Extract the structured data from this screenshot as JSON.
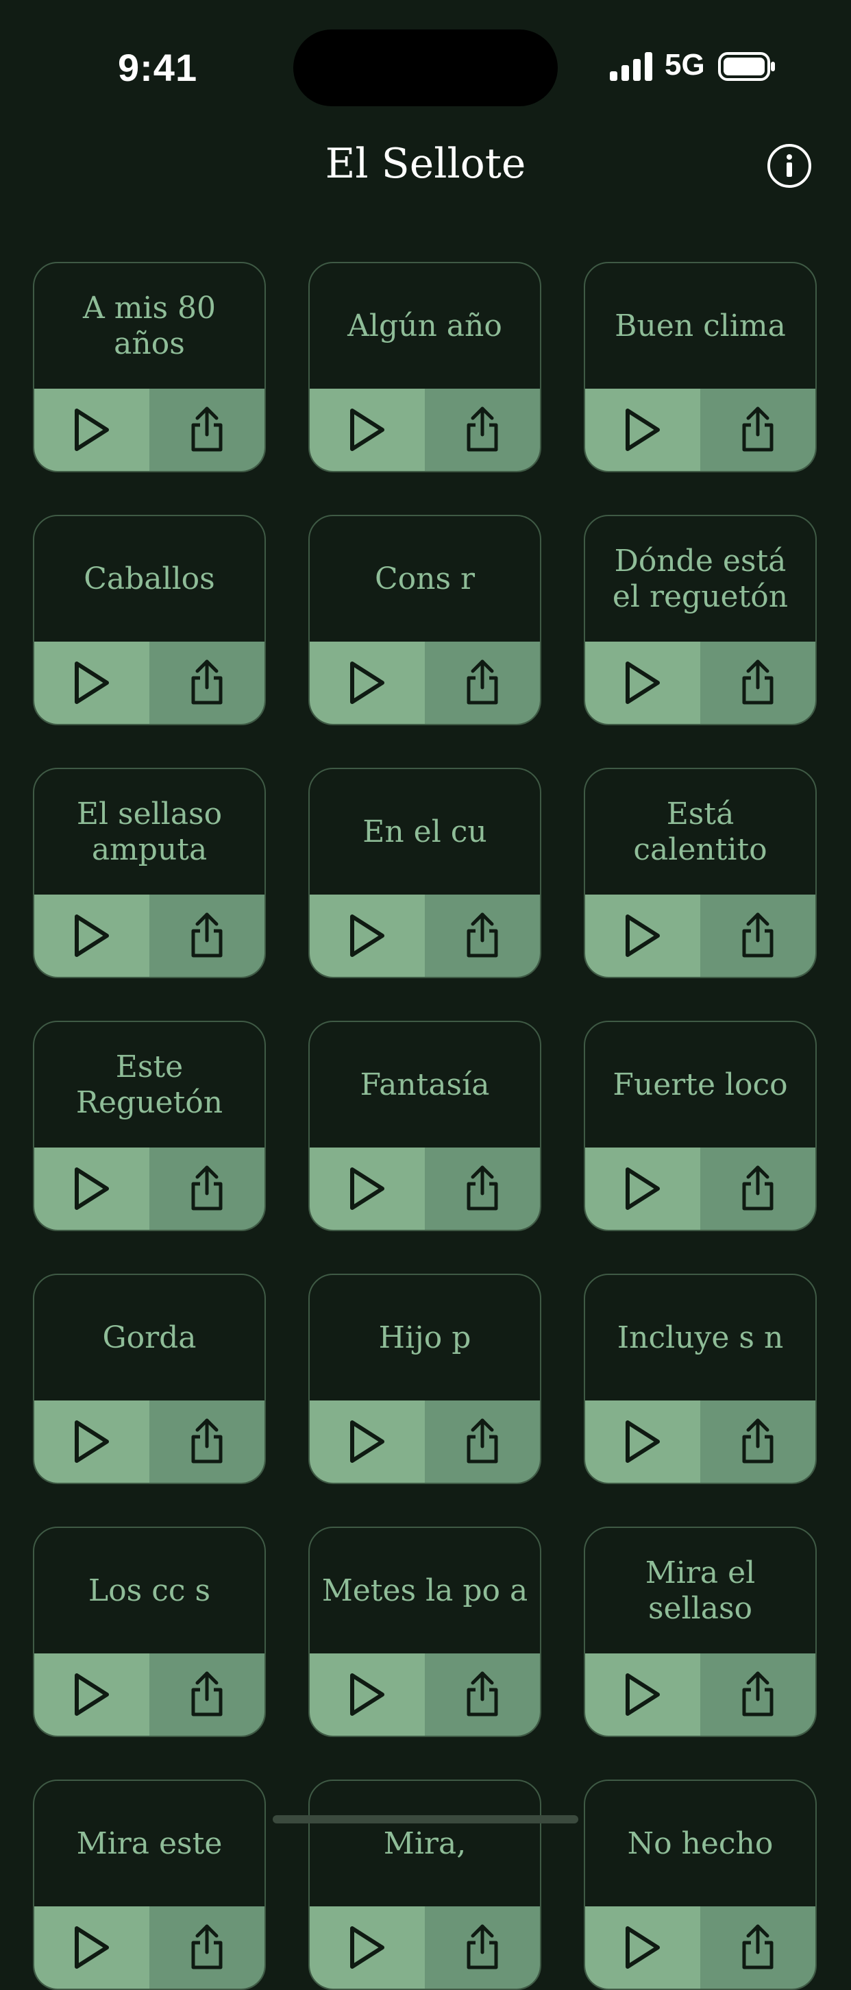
{
  "status": {
    "time": "9:41",
    "network": "5G"
  },
  "header": {
    "title": "El Sellote"
  },
  "colors": {
    "background": "#111c14",
    "play": "#84b08c",
    "share": "#6b9577",
    "label": "#8fbd98"
  },
  "sounds": [
    {
      "label": "A mis 80 años"
    },
    {
      "label": "Algún año"
    },
    {
      "label": "Buen clima"
    },
    {
      "label": "Caballos"
    },
    {
      "label": "Cons     r"
    },
    {
      "label": "Dónde está el reguetón"
    },
    {
      "label": "El sellaso amputa"
    },
    {
      "label": "En el cu"
    },
    {
      "label": "Está calentito"
    },
    {
      "label": "Este Reguetón"
    },
    {
      "label": "Fantasía"
    },
    {
      "label": "Fuerte loco"
    },
    {
      "label": "Gorda"
    },
    {
      "label": "Hijo p"
    },
    {
      "label": "Incluye s    n"
    },
    {
      "label": "Los cc      s"
    },
    {
      "label": "Metes la po    a"
    },
    {
      "label": "Mira el sellaso"
    },
    {
      "label": "Mira este"
    },
    {
      "label": "Mira,"
    },
    {
      "label": "No hecho"
    }
  ],
  "icons": {
    "play": "play-icon",
    "share": "share-icon",
    "info": "info-icon"
  }
}
